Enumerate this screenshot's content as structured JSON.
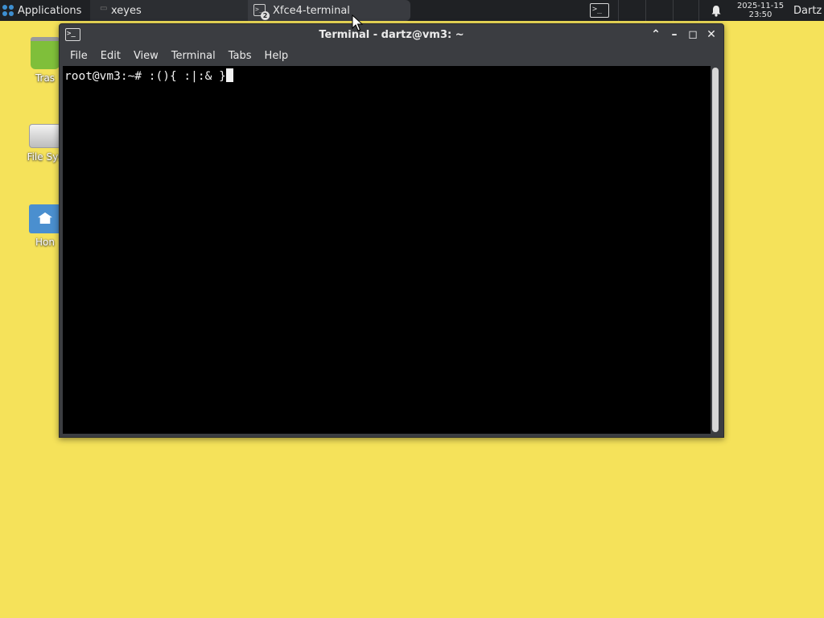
{
  "panel": {
    "applications_label": "Applications",
    "tasks": [
      {
        "label": "xeyes"
      },
      {
        "label": "Xfce4-terminal",
        "badge": "2"
      }
    ],
    "terminal_launcher_glyph": ">_",
    "clock": {
      "date": "2025-11-15",
      "time": "23:50"
    },
    "user": "Dartz"
  },
  "desktop": {
    "icons": [
      {
        "label": "Tras",
        "icon": "trash-icon"
      },
      {
        "label": "File Sys",
        "icon": "drive-icon"
      },
      {
        "label": "Hon",
        "icon": "home-folder-icon"
      }
    ]
  },
  "window": {
    "title": "Terminal - dartz@vm3: ~",
    "icon_glyph": ">_",
    "controls": {
      "shade": "⌃",
      "minimize": "–",
      "maximize": "◻",
      "close": "✕"
    },
    "menu": [
      "File",
      "Edit",
      "View",
      "Terminal",
      "Tabs",
      "Help"
    ],
    "terminal": {
      "prompt": "root@vm3:~# ",
      "command": ":(){ :|:& }"
    }
  },
  "colors": {
    "desktop_bg": "#f5e25a",
    "panel_bg": "#1f2124",
    "window_bg": "#3b3d41",
    "terminal_bg": "#000000",
    "accent_blue": "#3d8fd1"
  }
}
